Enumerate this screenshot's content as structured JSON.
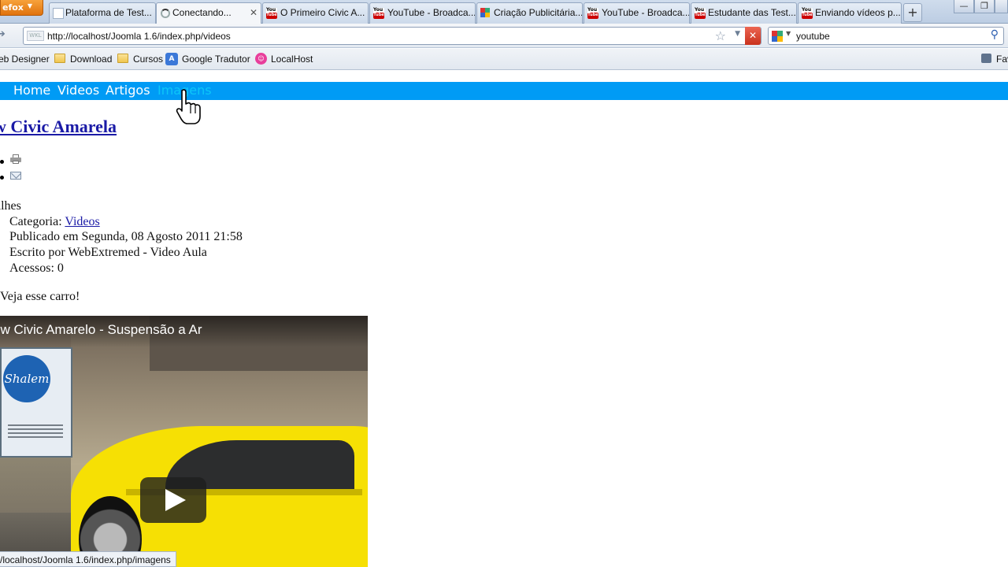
{
  "browser": {
    "app_button": "efox",
    "tabs": [
      {
        "title": "Plataforma de Test...",
        "icon": "blank-page-icon",
        "active": false
      },
      {
        "title": "Conectando...",
        "icon": "loading-spinner-icon",
        "active": true
      },
      {
        "title": "O Primeiro Civic A...",
        "icon": "youtube-icon",
        "active": false
      },
      {
        "title": "YouTube - Broadca...",
        "icon": "youtube-icon",
        "active": false
      },
      {
        "title": "Criação Publicitária...",
        "icon": "google-icon",
        "active": false
      },
      {
        "title": "YouTube - Broadca...",
        "icon": "youtube-icon",
        "active": false
      },
      {
        "title": "Estudante das Test...",
        "icon": "youtube-icon",
        "active": false
      },
      {
        "title": "Enviando vídeos p...",
        "icon": "youtube-icon",
        "active": false
      }
    ],
    "new_tab": "+",
    "url": "http://localhost/Joomla 1.6/index.php/videos",
    "url_site_badge": "WKL",
    "search_value": "youtube",
    "bookmarks": [
      {
        "label": "eb Designer"
      },
      {
        "label": "Download"
      },
      {
        "label": "Cursos"
      },
      {
        "label": "Google Tradutor"
      },
      {
        "label": "LocalHost"
      }
    ],
    "bookmarks_right": "Fav",
    "status_text": "/localhost/Joomla 1.6/index.php/imagens"
  },
  "page": {
    "menu": [
      {
        "label": "Home",
        "hover": false
      },
      {
        "label": "Videos",
        "hover": false
      },
      {
        "label": "Artigos",
        "hover": false
      },
      {
        "label": "Imagens",
        "hover": true
      }
    ],
    "article_title": "w Civic Amarela",
    "details_heading": "alhes",
    "category_label": "Categoria:",
    "category_link": "Videos",
    "published": "Publicado em Segunda, 08 Agosto 2011 21:58",
    "written_by": "Escrito por WebExtremed - Video Aula",
    "hits": "Acessos: 0",
    "intro": "Veja esse carro!",
    "video": {
      "title": "ew Civic Amarelo - Suspensão a Ar",
      "sign_text": "Shalem"
    }
  },
  "colors": {
    "menu_bar": "#009bf5",
    "menu_hover": "#0cc6f8",
    "link": "#1a1aa6",
    "car": "#f6e004"
  }
}
